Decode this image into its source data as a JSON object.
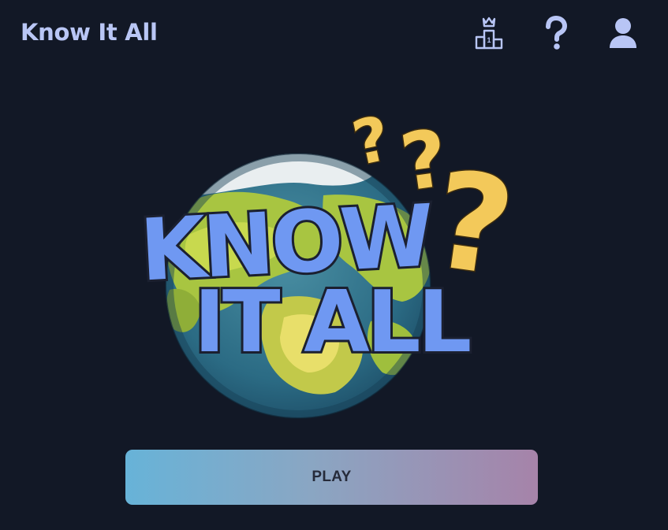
{
  "header": {
    "app_title": "Know It All",
    "icons": [
      "leaderboard-icon",
      "help-icon",
      "profile-icon"
    ]
  },
  "logo": {
    "line1": "KNOW",
    "line2": "IT ALL",
    "decoration": "globe-with-question-marks"
  },
  "actions": {
    "play_label": "PLAY"
  },
  "colors": {
    "background": "#121826",
    "title": "#b9c6f5",
    "icon": "#b8c5f5",
    "logo_letters": "#6f98f2",
    "question_marks": "#f3c95a",
    "play_gradient_start": "#67b3d8",
    "play_gradient_end": "#a683a9"
  }
}
